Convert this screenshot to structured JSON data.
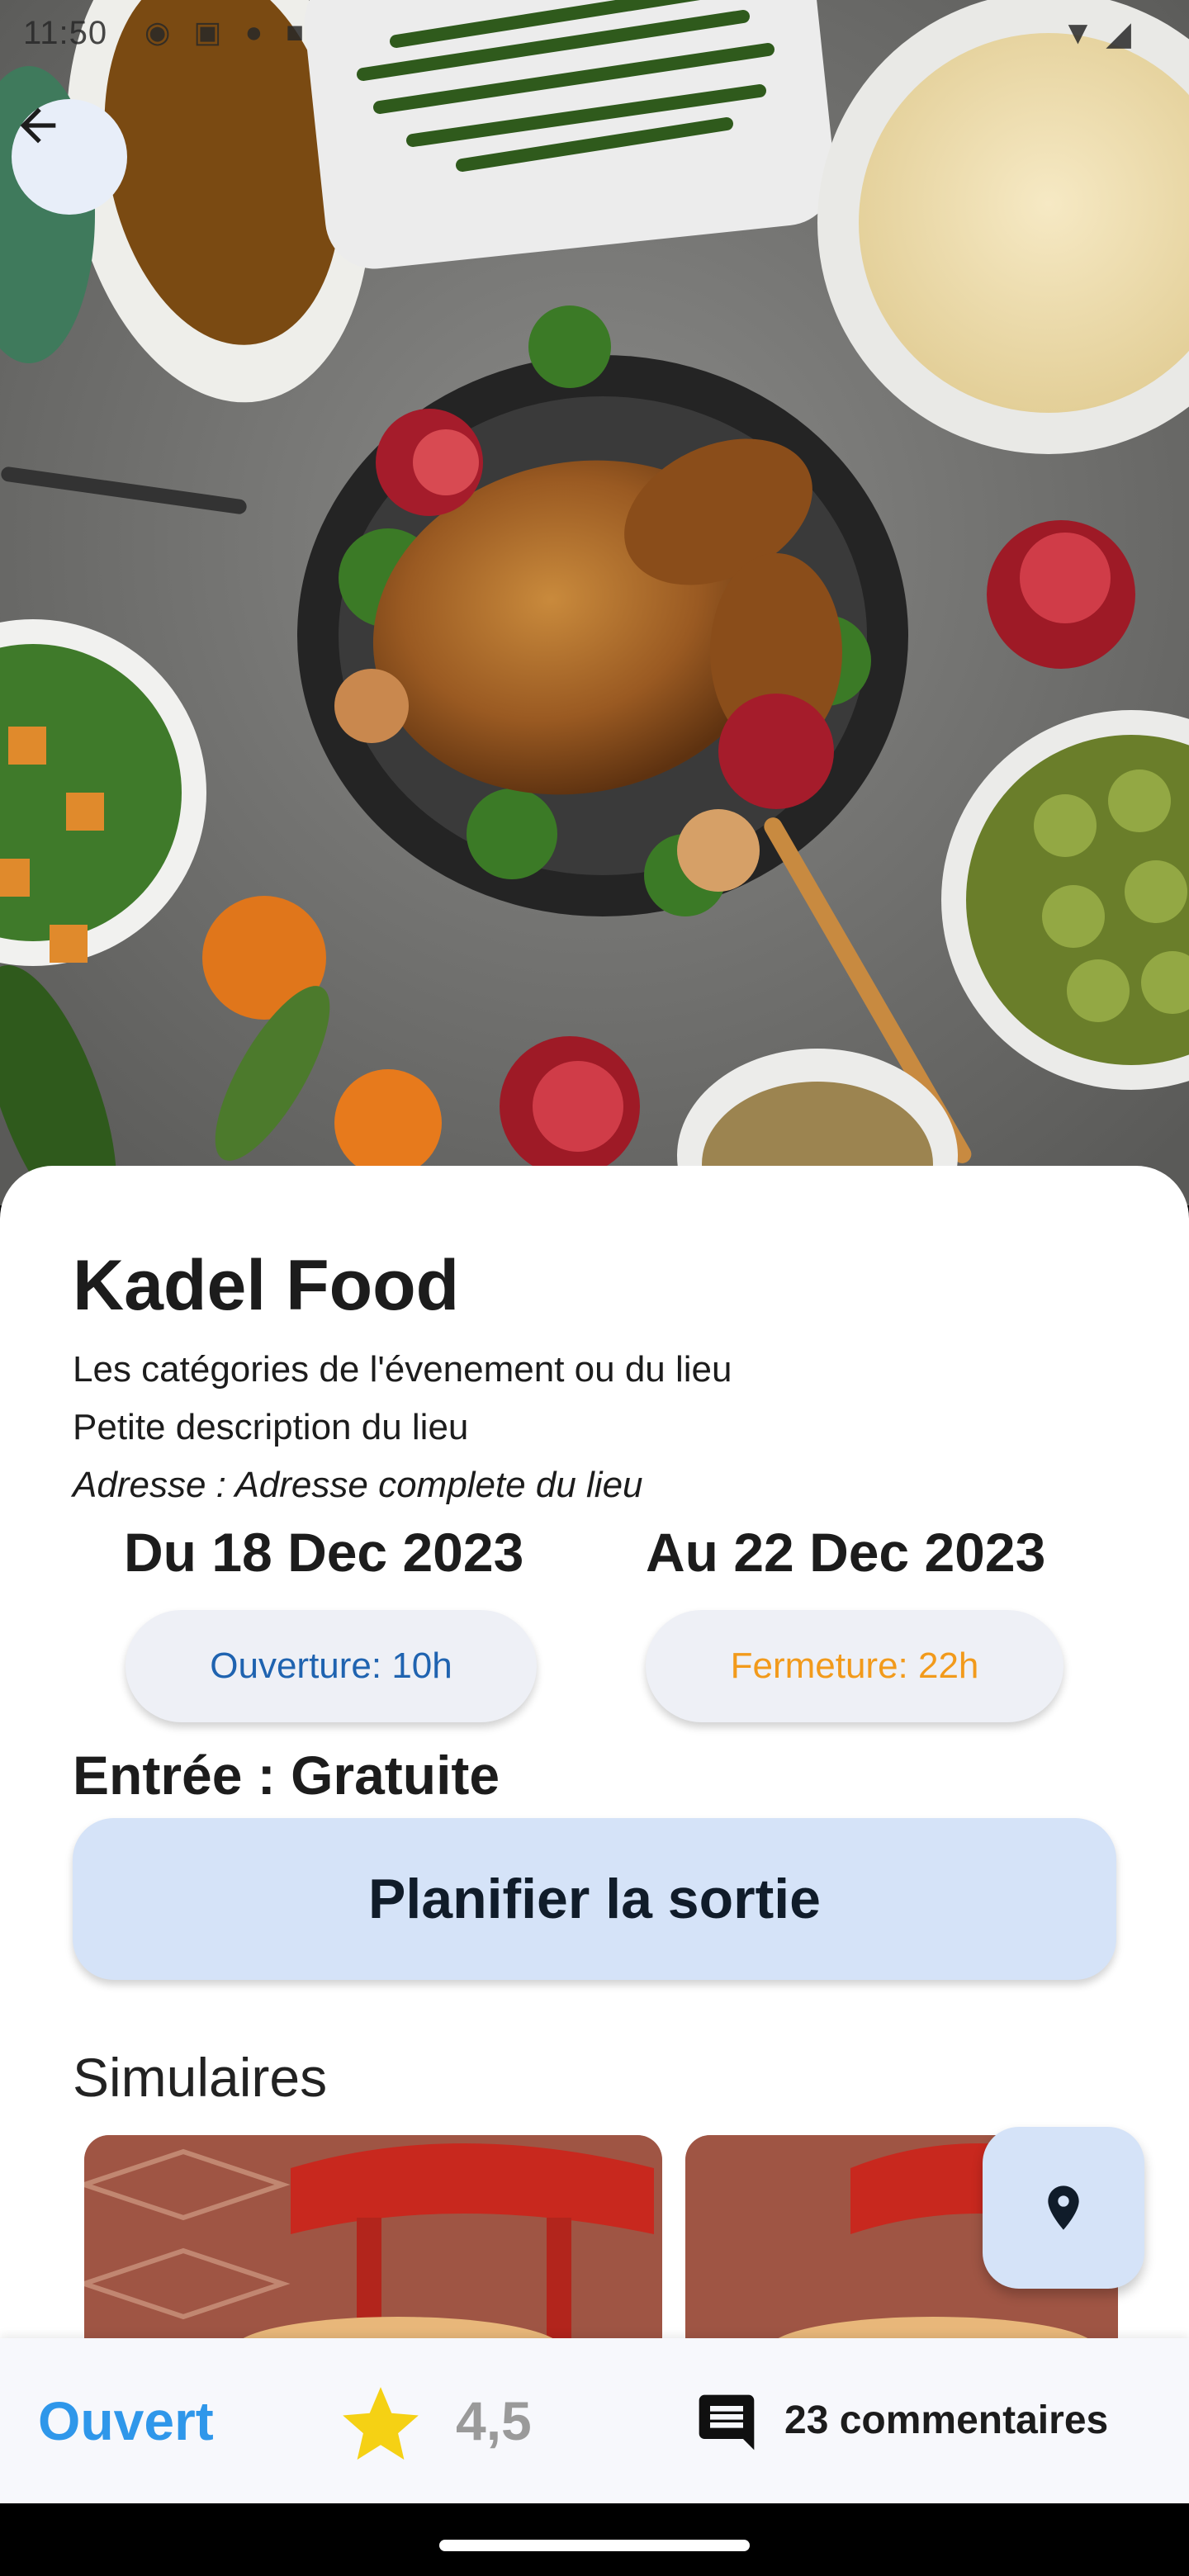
{
  "status_bar": {
    "time": "11:50"
  },
  "place": {
    "name": "Kadel Food",
    "categories": "Les catégories de l'évenement ou du lieu",
    "description": "Petite description du lieu",
    "address": "Adresse : Adresse complete du lieu",
    "date_from": "Du 18 Dec 2023",
    "date_to": "Au 22 Dec 2023",
    "opening": "Ouverture: 10h",
    "closing": "Fermeture: 22h",
    "entry": "Entrée : Gratuite"
  },
  "actions": {
    "plan_label": "Planifier la sortie"
  },
  "similar": {
    "title": "Simulaires",
    "items": [
      {},
      {}
    ]
  },
  "bottom_bar": {
    "status": "Ouvert",
    "rating": "4,5",
    "comments": "23 commentaires"
  },
  "colors": {
    "accent_blue": "#2f97ea",
    "opening_blue": "#1f63b0",
    "closing_orange": "#f29a1b",
    "button_bg": "#d5e3f8",
    "star_yellow": "#f5d114"
  },
  "icons": {
    "back": "arrow-left-icon",
    "map": "location-pin-icon",
    "rating": "star-icon",
    "comments": "comment-icon"
  }
}
